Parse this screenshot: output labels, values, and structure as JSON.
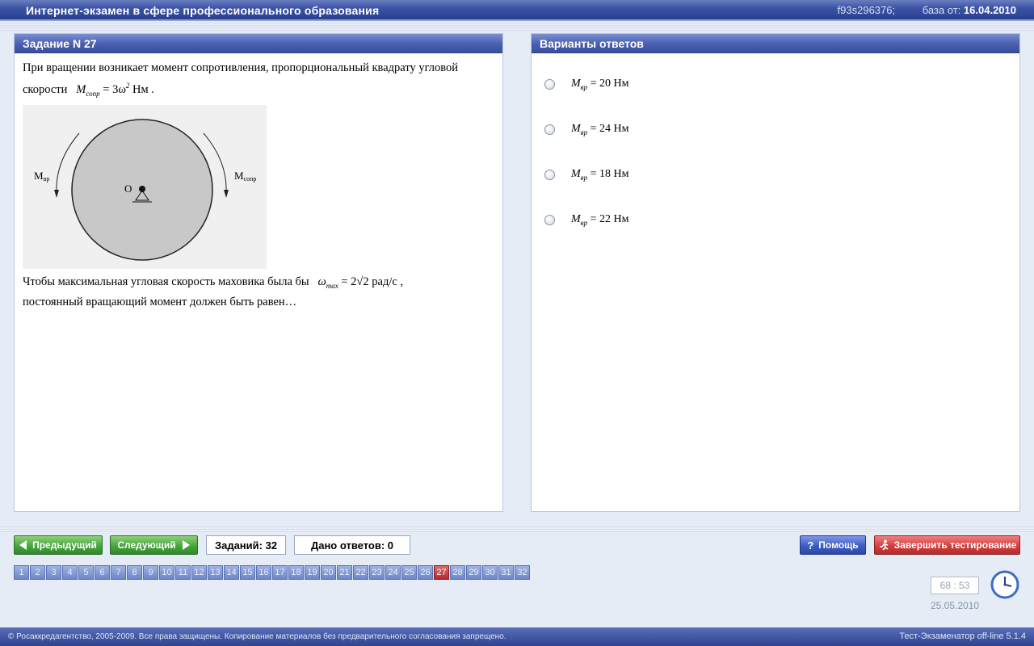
{
  "header": {
    "title": "Интернет-экзамен в сфере профессионального образования",
    "code": "f93s296376;",
    "base_label": "база от:",
    "base_date": "16.04.2010"
  },
  "task": {
    "title": "Задание N 27",
    "line1": "При вращении возникает момент сопротивления, пропорциональный квадрату угловой",
    "line2_prefix": "скорости",
    "formula_M": "M",
    "formula_M_sub": "сопр",
    "formula_rhs": "= 3ω",
    "formula_rhs_sup": "2",
    "formula_unit": "Нм .",
    "figure": {
      "label_left": "M",
      "label_left_sub": "вр",
      "label_center": "O",
      "label_right": "M",
      "label_right_sub": "сопр"
    },
    "line3_prefix": "Чтобы максимальная угловая скорость маховика была бы",
    "omega": "ω",
    "omega_sub": "max",
    "omega_rhs": "= 2√2",
    "omega_unit": "рад/с ,",
    "line4": "постоянный вращающий момент  должен быть равен…"
  },
  "answers": {
    "title": "Варианты ответов",
    "options": [
      {
        "symbol": "M",
        "sub": "вр",
        "value": "= 20 Нм"
      },
      {
        "symbol": "M",
        "sub": "вр",
        "value": "= 24 Нм"
      },
      {
        "symbol": "M",
        "sub": "вр",
        "value": "= 18 Нм"
      },
      {
        "symbol": "M",
        "sub": "вр",
        "value": "= 22 Нм"
      }
    ]
  },
  "toolbar": {
    "prev_label": "Предыдущий",
    "next_label": "Следующий",
    "tasks_count": "Заданий: 32",
    "answers_given": "Дано ответов: 0",
    "help_label": "Помощь",
    "finish_label": "Завершить тестирование"
  },
  "pager": {
    "pages": [
      "1",
      "2",
      "3",
      "4",
      "5",
      "6",
      "7",
      "8",
      "9",
      "10",
      "11",
      "12",
      "13",
      "14",
      "15",
      "16",
      "17",
      "18",
      "19",
      "20",
      "21",
      "22",
      "23",
      "24",
      "25",
      "26",
      "27",
      "28",
      "29",
      "30",
      "31",
      "32"
    ],
    "current": "27"
  },
  "timer": "68 : 53",
  "date": "25.05.2010",
  "footer": {
    "copyright": "© Росаккредагентство, 2005-2009. Все права защищены. Копирование материалов без предварительного согласования запрещено.",
    "version": "Тест-Экзаменатор off-line 5.1.4"
  },
  "icons": {
    "prev": "arrow-left-icon",
    "next": "arrow-right-icon",
    "help": "question-icon",
    "finish": "running-man-icon",
    "clock": "clock-icon"
  },
  "colors": {
    "header_blue": "#3d54a6",
    "green_button": "#46a63c",
    "red_button": "#d43f3f",
    "active_page": "#b22d2d"
  }
}
